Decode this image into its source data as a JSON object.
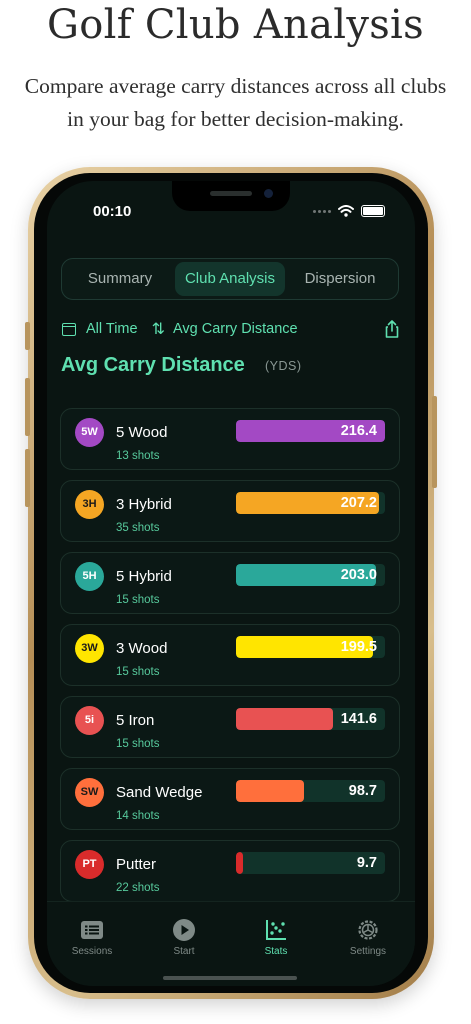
{
  "header": {
    "title": "Golf Club Analysis",
    "subtitle": "Compare average carry distances across all clubs in your bag for better decision-making."
  },
  "status_bar": {
    "time": "00:10"
  },
  "segments": [
    {
      "label": "Summary",
      "active": false
    },
    {
      "label": "Club Analysis",
      "active": true
    },
    {
      "label": "Dispersion",
      "active": false
    }
  ],
  "filters": {
    "period": "All Time",
    "sort": "Avg Carry Distance"
  },
  "section": {
    "title": "Avg Carry Distance",
    "unit": "(YDS)"
  },
  "scale_max": 216.4,
  "clubs": [
    {
      "abbr": "5W",
      "name": "5 Wood",
      "shots": "13 shots",
      "value": 216.4,
      "label": "216.4",
      "color": "#a349c4",
      "text_color": "#ffffff"
    },
    {
      "abbr": "3H",
      "name": "3 Hybrid",
      "shots": "35 shots",
      "value": 207.2,
      "label": "207.2",
      "color": "#f5a623",
      "text_color": "#1a1a1a"
    },
    {
      "abbr": "5H",
      "name": "5 Hybrid",
      "shots": "15 shots",
      "value": 203.0,
      "label": "203.0",
      "color": "#2aa89a",
      "text_color": "#ffffff"
    },
    {
      "abbr": "3W",
      "name": "3 Wood",
      "shots": "15 shots",
      "value": 199.5,
      "label": "199.5",
      "color": "#ffe500",
      "text_color": "#1a1a1a"
    },
    {
      "abbr": "5i",
      "name": "5 Iron",
      "shots": "15 shots",
      "value": 141.6,
      "label": "141.6",
      "color": "#e85252",
      "text_color": "#ffffff"
    },
    {
      "abbr": "SW",
      "name": "Sand Wedge",
      "shots": "14 shots",
      "value": 98.7,
      "label": "98.7",
      "color": "#ff6f3c",
      "text_color": "#1a1a1a"
    },
    {
      "abbr": "PT",
      "name": "Putter",
      "shots": "22 shots",
      "value": 9.7,
      "label": "9.7",
      "color": "#d92b2b",
      "text_color": "#ffffff"
    }
  ],
  "tabs": [
    {
      "label": "Sessions",
      "icon": "list-icon",
      "active": false
    },
    {
      "label": "Start",
      "icon": "play-icon",
      "active": false
    },
    {
      "label": "Stats",
      "icon": "scatter-chart-icon",
      "active": true
    },
    {
      "label": "Settings",
      "icon": "gear-icon",
      "active": false
    }
  ]
}
